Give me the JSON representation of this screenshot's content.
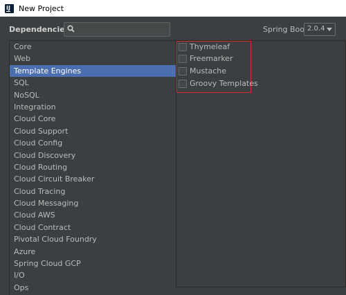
{
  "window": {
    "title": "New Project"
  },
  "toolbar": {
    "dependencies_label": "Dependencies",
    "search_value": "",
    "spring_boot_label": "Spring Boot",
    "spring_boot_version": "2.0.4"
  },
  "categories": [
    {
      "label": "Core"
    },
    {
      "label": "Web"
    },
    {
      "label": "Template Engines"
    },
    {
      "label": "SQL"
    },
    {
      "label": "NoSQL"
    },
    {
      "label": "Integration"
    },
    {
      "label": "Cloud Core"
    },
    {
      "label": "Cloud Support"
    },
    {
      "label": "Cloud Config"
    },
    {
      "label": "Cloud Discovery"
    },
    {
      "label": "Cloud Routing"
    },
    {
      "label": "Cloud Circuit Breaker"
    },
    {
      "label": "Cloud Tracing"
    },
    {
      "label": "Cloud Messaging"
    },
    {
      "label": "Cloud AWS"
    },
    {
      "label": "Cloud Contract"
    },
    {
      "label": "Pivotal Cloud Foundry"
    },
    {
      "label": "Azure"
    },
    {
      "label": "Spring Cloud GCP"
    },
    {
      "label": "I/O"
    },
    {
      "label": "Ops"
    }
  ],
  "selected_category": "Template Engines",
  "options": [
    {
      "label": "Thymeleaf",
      "checked": false
    },
    {
      "label": "Freemarker",
      "checked": false
    },
    {
      "label": "Mustache",
      "checked": false
    },
    {
      "label": "Groovy Templates",
      "checked": false
    }
  ],
  "colors": {
    "background": "#3c3f41",
    "selection": "#4b6eaf",
    "highlight_border": "#d22c2c"
  }
}
